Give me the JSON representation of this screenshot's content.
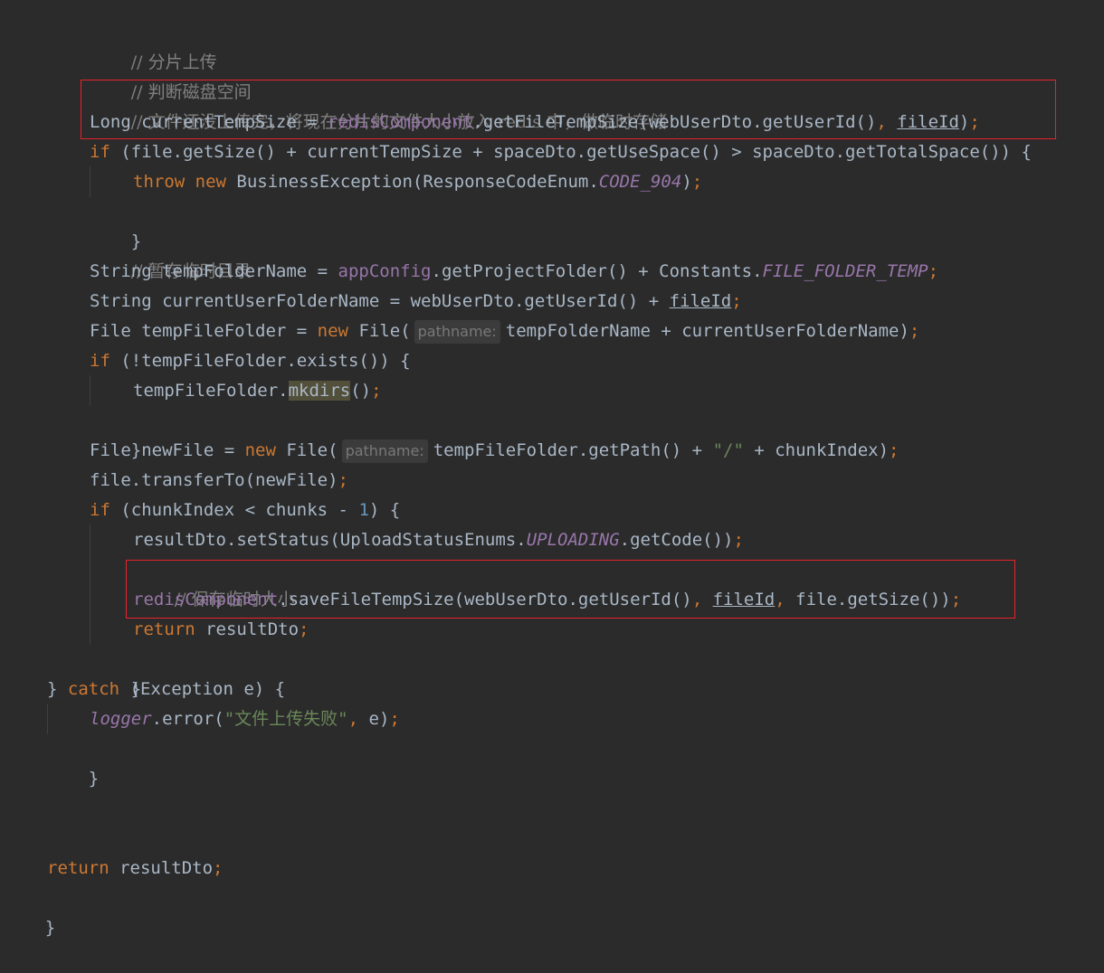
{
  "code": {
    "l1_comment": "// 分片上传",
    "l2_comment": "// 判断磁盘空间",
    "l3_comment": "// 文件还没上传完，将现在分片的文件大小放入 redis 中，做临时存储",
    "l4": {
      "a": "Long currentTempSize = ",
      "field": "redisComponent",
      "b": ".getFileTempSize(webUserDto.getUserId()",
      "comma": ", ",
      "var": "fileId",
      "c": ")",
      "semi": ";"
    },
    "l5": {
      "kw": "if",
      "rest": " (file.getSize() + currentTempSize + spaceDto.getUseSpace() > spaceDto.getTotalSpace()) {"
    },
    "l6": {
      "kw1": "throw",
      "kw2": "new",
      "a": " BusinessException(ResponseCodeEnum.",
      "const": "CODE_904",
      "b": ")",
      "semi": ";"
    },
    "close_brace": "}",
    "l8_comment": "// 暂存临时目录",
    "l9": {
      "a": "String tempFolderName = ",
      "field": "appConfig",
      "b": ".getProjectFolder() + Constants.",
      "const": "FILE_FOLDER_TEMP",
      "semi": ";"
    },
    "l10": {
      "a": "String currentUserFolderName = webUserDto.getUserId() + ",
      "var": "fileId",
      "semi": ";"
    },
    "l11": {
      "a": "File tempFileFolder = ",
      "kw": "new",
      "b": " File(",
      "hint": "pathname:",
      "c": "tempFolderName + currentUserFolderName)",
      "semi": ";"
    },
    "l12": {
      "kw": "if",
      "rest": " (!tempFileFolder.exists()) {"
    },
    "l13": {
      "a": "tempFileFolder.",
      "hl": "mkdirs",
      "b": "()",
      "semi": ";"
    },
    "l15": {
      "a": "File newFile = ",
      "kw": "new",
      "b": " File(",
      "hint": "pathname:",
      "c": "tempFileFolder.getPath() + ",
      "str": "\"/\"",
      "d": " + chunkIndex)",
      "semi": ";"
    },
    "l16": {
      "a": "file.transferTo(newFile)",
      "semi": ";"
    },
    "l17": {
      "kw": "if",
      "a": " (chunkIndex < chunks - ",
      "num": "1",
      "b": ") {"
    },
    "l18": {
      "a": "resultDto.setStatus(UploadStatusEnums.",
      "const": "UPLOADING",
      "b": ".getCode())",
      "semi": ";"
    },
    "l19_comment": "// 保存临时大小",
    "l20": {
      "field": "redisComponent",
      "a": ".saveFileTempSize(webUserDto.getUserId()",
      "comma1": ", ",
      "var": "fileId",
      "comma2": ", ",
      "b": "file.getSize())",
      "semi": ";"
    },
    "l21": {
      "kw": "return",
      "rest": " resultDto",
      "semi": ";"
    },
    "l23": {
      "a": "} ",
      "kw": "catch",
      "b": " (Exception e) {"
    },
    "l24": {
      "field": "logger",
      "a": ".error(",
      "str": "\"文件上传失败\"",
      "comma": ", ",
      "b": "e)",
      "semi": ";"
    },
    "l29": {
      "kw": "return",
      "rest": " resultDto",
      "semi": ";"
    }
  },
  "highlight_color": "#e8222d"
}
